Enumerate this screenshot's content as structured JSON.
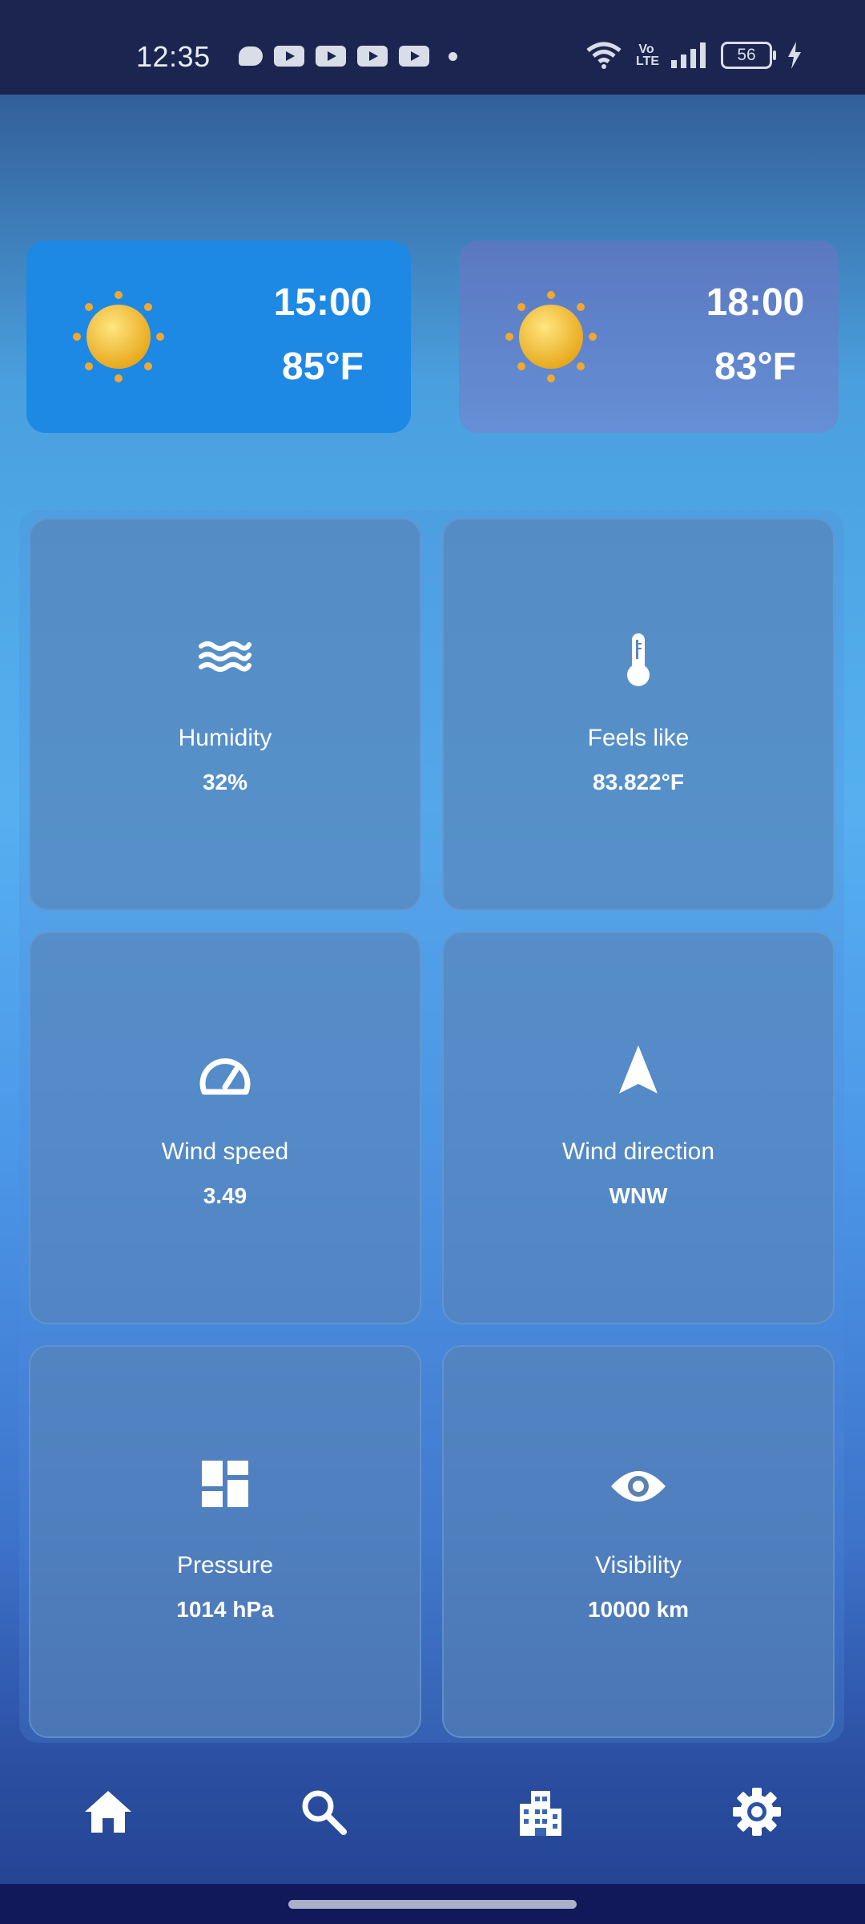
{
  "status_bar": {
    "time": "12:35",
    "battery": "56",
    "volte": "Vo LTE"
  },
  "forecast": [
    {
      "time": "15:00",
      "temp": "85°F",
      "icon": "sun-icon"
    },
    {
      "time": "18:00",
      "temp": "83°F",
      "icon": "sun-icon"
    }
  ],
  "details": [
    {
      "label": "Humidity",
      "value": "32%",
      "icon": "waves-icon"
    },
    {
      "label": "Feels like",
      "value": "83.822°F",
      "icon": "thermometer-icon"
    },
    {
      "label": "Wind speed",
      "value": "3.49",
      "icon": "speedometer-icon"
    },
    {
      "label": "Wind direction",
      "value": "WNW",
      "icon": "navigation-arrow-icon"
    },
    {
      "label": "Pressure",
      "value": "1014 hPa",
      "icon": "dashboard-icon"
    },
    {
      "label": "Visibility",
      "value": "10000 km",
      "icon": "eye-icon"
    }
  ],
  "nav": [
    {
      "name": "home",
      "icon": "home-icon"
    },
    {
      "name": "search",
      "icon": "search-icon"
    },
    {
      "name": "cities",
      "icon": "city-icon"
    },
    {
      "name": "settings",
      "icon": "gear-icon"
    }
  ],
  "colors": {
    "active_card": "#1e88e5",
    "status_bar": "#1b2550",
    "sun": "#f5c33b"
  }
}
